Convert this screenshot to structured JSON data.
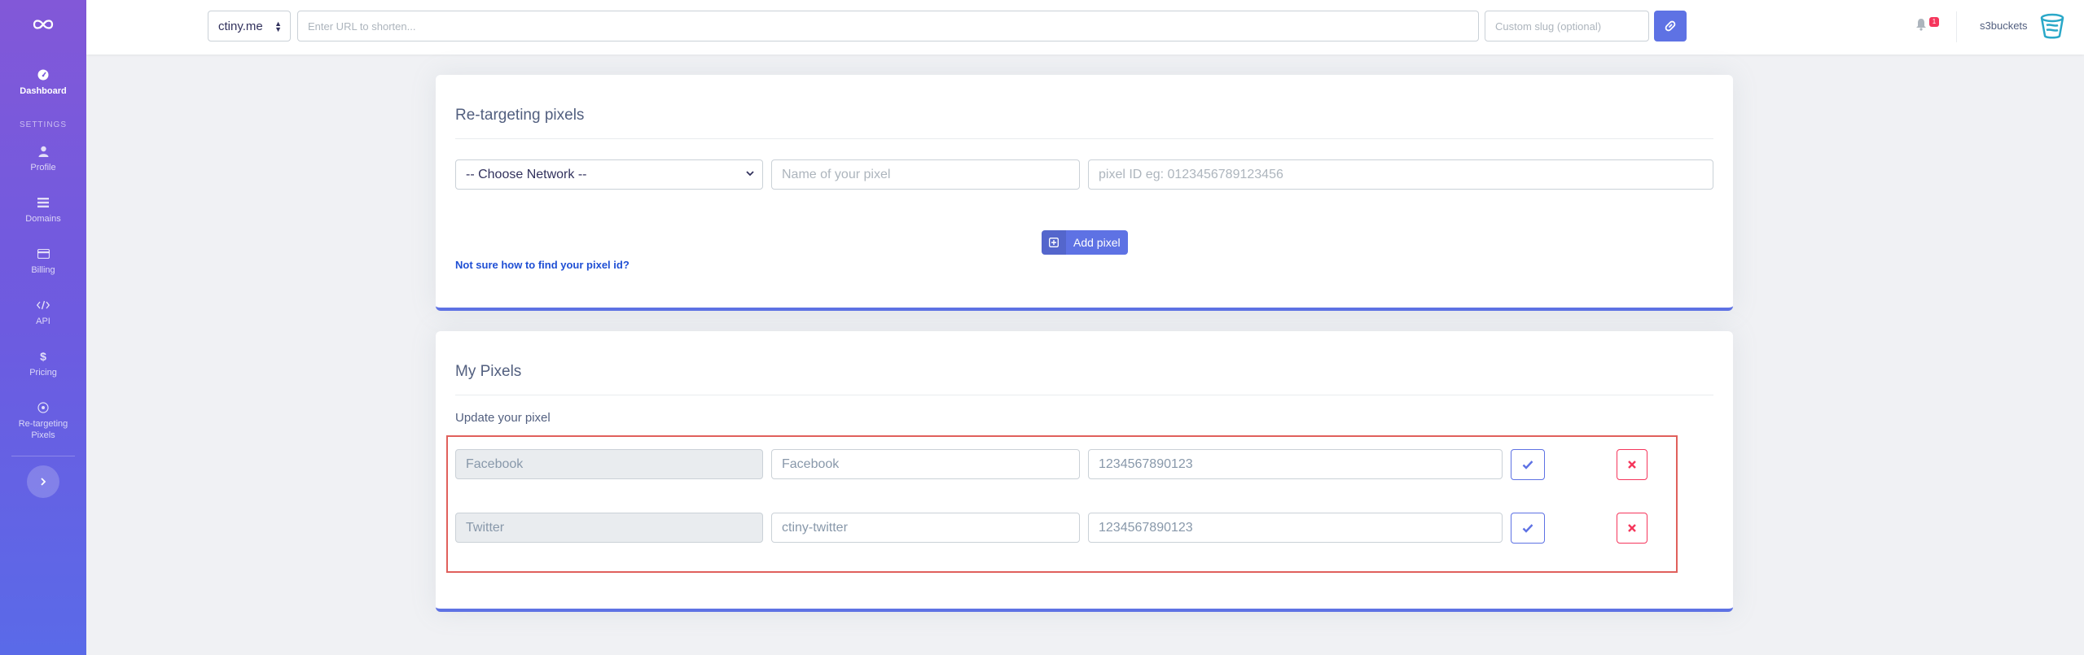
{
  "sidebar": {
    "logo_icon": "link-loop-icon",
    "heading": "SETTINGS",
    "items": [
      {
        "label": "Dashboard",
        "icon": "gauge-icon"
      },
      {
        "label": "Profile",
        "icon": "user-icon"
      },
      {
        "label": "Domains",
        "icon": "list-icon"
      },
      {
        "label": "Billing",
        "icon": "credit-card-icon"
      },
      {
        "label": "API",
        "icon": "code-icon"
      },
      {
        "label": "Pricing",
        "icon": "dollar-icon"
      },
      {
        "label": "Re-targeting",
        "label2": "Pixels",
        "icon": "target-icon"
      }
    ]
  },
  "topbar": {
    "domain": "ctiny.me",
    "url_placeholder": "Enter URL to shorten...",
    "slug_placeholder": "Custom slug (optional)",
    "notification_count": "1",
    "username": "s3buckets"
  },
  "retargeting": {
    "title": "Re-targeting pixels",
    "network_select": "-- Choose Network --",
    "name_placeholder": "Name of your pixel",
    "id_placeholder": "pixel ID eg: 0123456789123456",
    "add_label": "Add pixel",
    "help_link": "Not sure how to find your pixel id?"
  },
  "my_pixels": {
    "title": "My Pixels",
    "subtitle": "Update your pixel",
    "rows": [
      {
        "network": "Facebook",
        "name": "Facebook",
        "pixel_id": "1234567890123"
      },
      {
        "network": "Twitter",
        "name": "ctiny-twitter",
        "pixel_id": "1234567890123"
      }
    ]
  },
  "colors": {
    "primary": "#5e72e4",
    "danger": "#f5365c",
    "sidebar_top": "#8258d8",
    "sidebar_bottom": "#5a6ae8",
    "link": "#1f4fd4"
  }
}
